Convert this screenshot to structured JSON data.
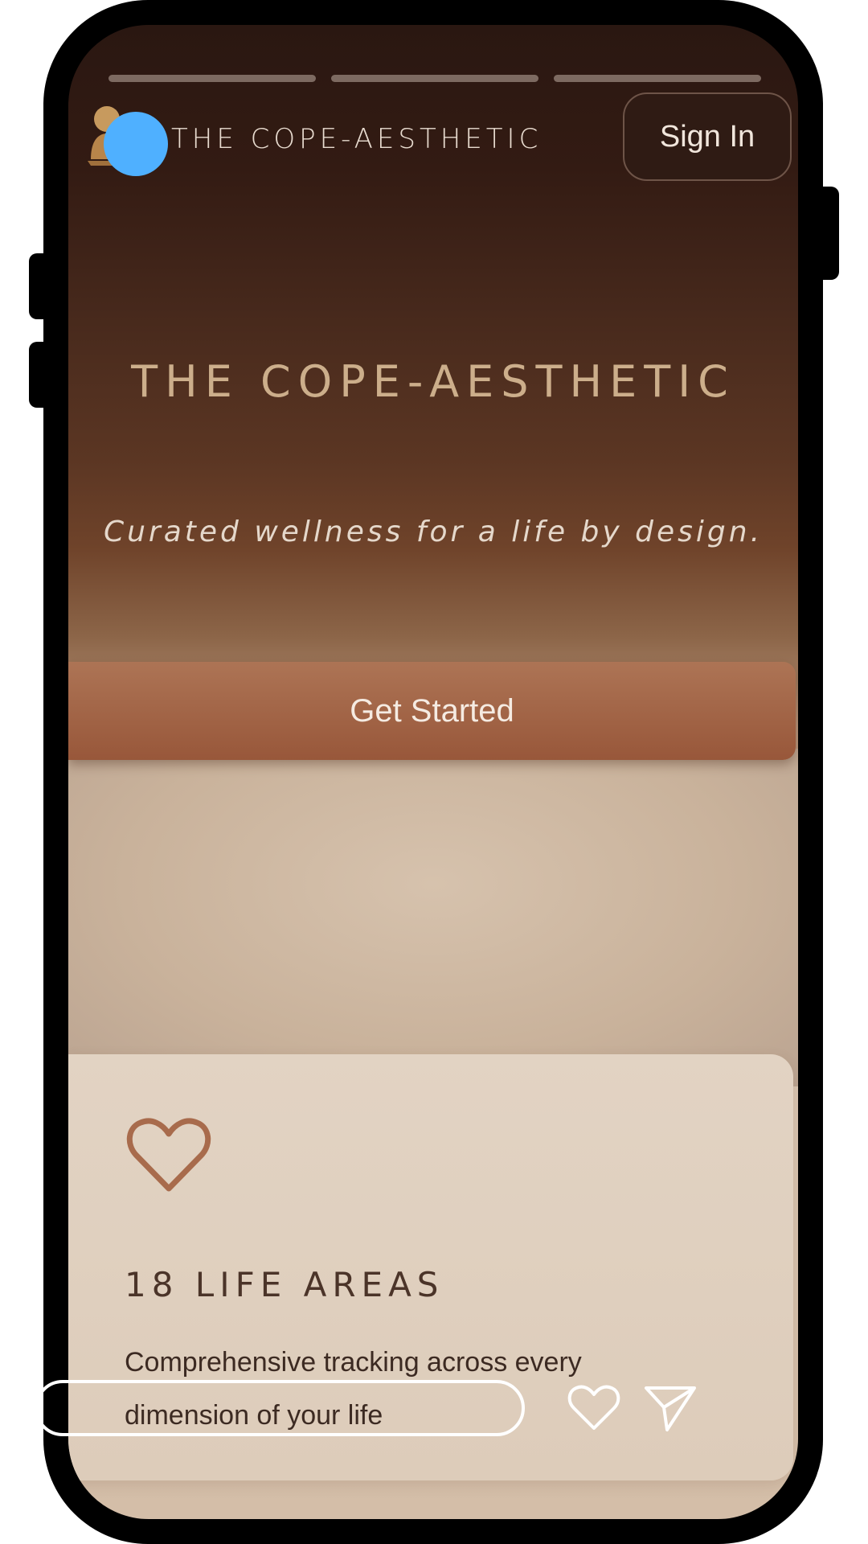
{
  "header": {
    "brand": "THE COPE-AESTHETIC",
    "sign_in_label": "Sign In",
    "story_segments": 3
  },
  "hero": {
    "title": "THE COPE-AESTHETIC",
    "subtitle": "Curated wellness for a life by design.",
    "cta_label": "Get Started"
  },
  "feature_card": {
    "icon": "heart-icon",
    "title": "18 LIFE AREAS",
    "description": "Comprehensive tracking across every dimension of your life"
  },
  "footer": {
    "reply_placeholder": "",
    "like_icon": "heart-outline-icon",
    "send_icon": "send-icon"
  },
  "colors": {
    "accent": "#a86b4c",
    "title_gold": "#ccae8b",
    "touch_indicator": "#4fb0ff"
  }
}
